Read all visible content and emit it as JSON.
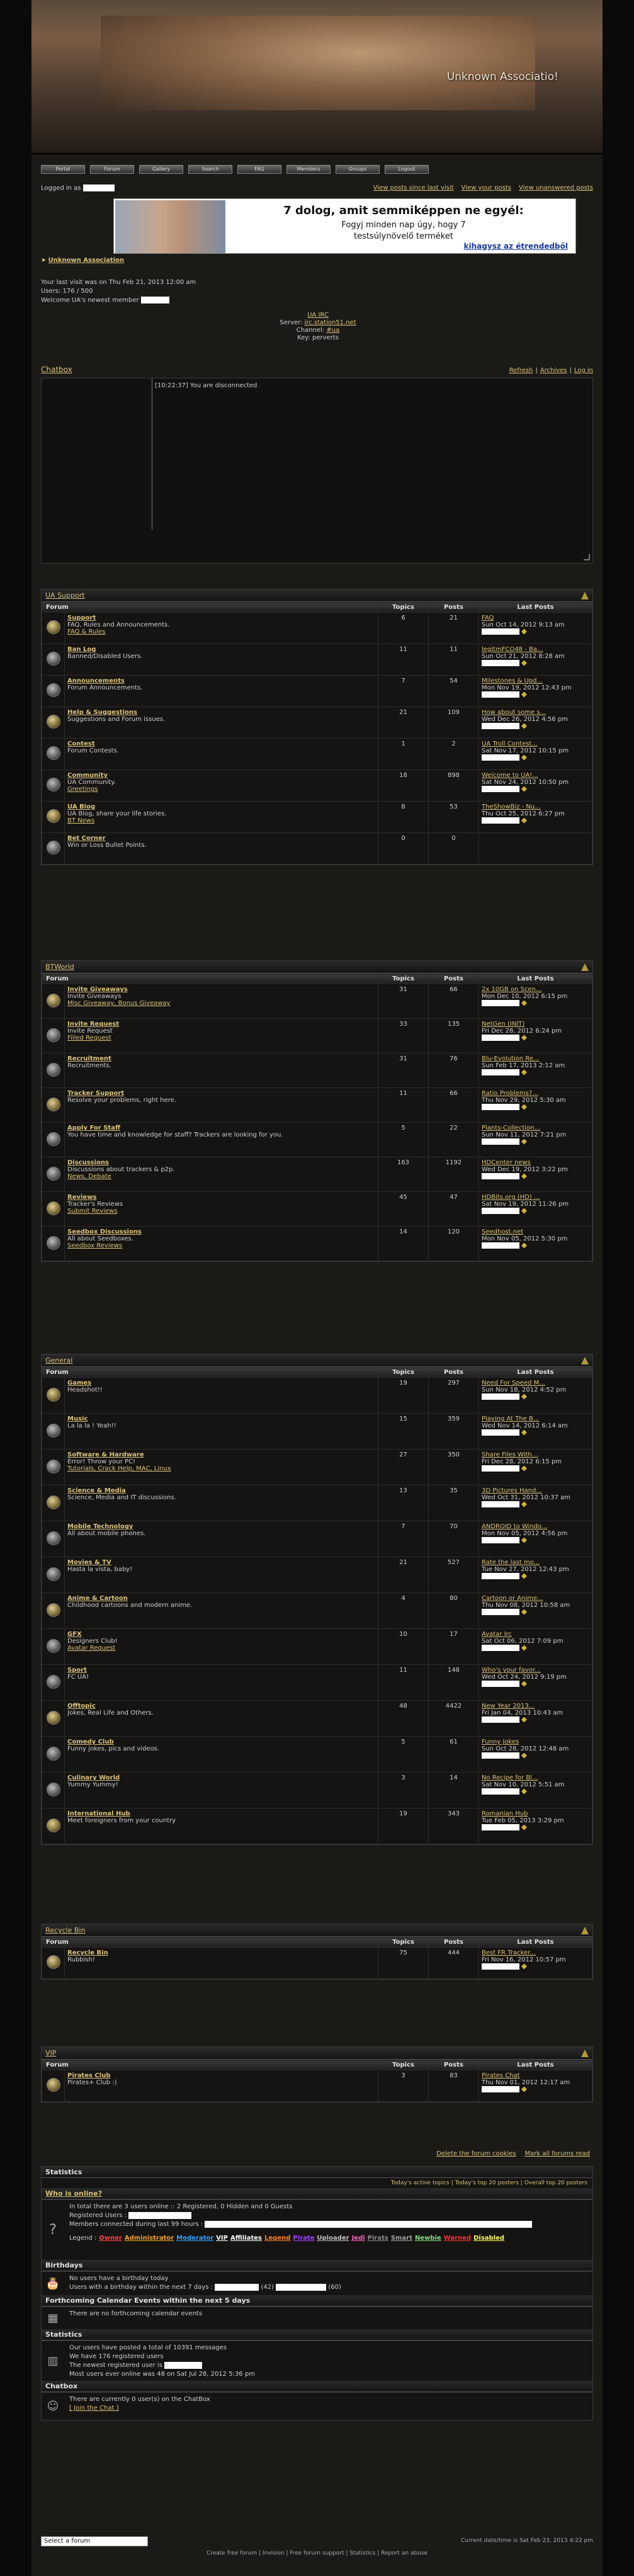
{
  "site": {
    "title": "Unknown Associatio!"
  },
  "nav": {
    "items": [
      "Portal",
      "Forum",
      "Gallery",
      "Search",
      "FAQ",
      "Members",
      "Groups",
      "Logout"
    ]
  },
  "header": {
    "logged_in_as": "Logged in as",
    "links": [
      "View posts since last visit",
      "View your posts",
      "View unanswered posts"
    ],
    "breadcrumb": "Unknown Association",
    "last_visit": "Your last visit was on Thu Feb 21, 2013 12:00 am",
    "users": "Users: 176 / 500",
    "newest": "Welcome UA's newest member"
  },
  "ad": {
    "headline": "7 dolog, amit semmiképpen ne egyél:",
    "line1": "Fogyj minden nap úgy, hogy 7",
    "line2": "testsúlynövelő terméket",
    "cta": "kihagysz az étrendedből"
  },
  "irc": {
    "title": "UA IRC",
    "server_label": "Server:",
    "server": "irc.station51.net",
    "channel_label": "Channel:",
    "channel": "#ua",
    "key": "Key: perverts"
  },
  "chatbox": {
    "title": "Chatbox",
    "links": [
      "Refresh",
      "Archives",
      "Log in"
    ],
    "message": "[10:22:37] You are disconnected"
  },
  "table_headers": {
    "forum": "Forum",
    "topics": "Topics",
    "posts": "Posts",
    "last": "Last Posts"
  },
  "categories": [
    {
      "name": "UA Support",
      "forums": [
        {
          "name": "Support",
          "desc": "FAQ, Rules and Announcements.",
          "sub": "FAQ & Rules",
          "topics": "6",
          "posts": "21",
          "last_title": "FAQ",
          "last_date": "Sun Oct 14, 2012 9:13 am"
        },
        {
          "name": "Ban Log",
          "desc": "Banned/Disabled Users.",
          "sub": "",
          "topics": "11",
          "posts": "11",
          "last_title": "legitmFCO48 - Ba...",
          "last_date": "Sun Oct 21, 2012 8:28 am"
        },
        {
          "name": "Announcements",
          "desc": "Forum Announcements.",
          "sub": "",
          "topics": "7",
          "posts": "54",
          "last_title": "Milestones & Upd...",
          "last_date": "Mon Nov 19, 2012 12:43 pm"
        },
        {
          "name": "Help & Suggestions",
          "desc": "Suggestions and Forum issues.",
          "sub": "",
          "topics": "21",
          "posts": "109",
          "last_title": "How about some s...",
          "last_date": "Wed Dec 26, 2012 4:56 pm"
        },
        {
          "name": "Contest",
          "desc": "Forum Contests.",
          "sub": "",
          "topics": "1",
          "posts": "2",
          "last_title": "UA Troll Contest...",
          "last_date": "Sat Nov 17, 2012 10:15 pm"
        },
        {
          "name": "Community",
          "desc": "UA Community.",
          "sub": "Greetings",
          "topics": "18",
          "posts": "898",
          "last_title": "Welcome to UA!...",
          "last_date": "Sat Nov 24, 2012 10:50 pm"
        },
        {
          "name": "UA Blog",
          "desc": "UA Blog, share your life stories.",
          "sub": "BT News",
          "topics": "8",
          "posts": "53",
          "last_title": "TheShowBiz - Nu...",
          "last_date": "Thu Oct 25, 2012 6:27 pm"
        },
        {
          "name": "Bet Corner",
          "desc": "Win or Loss Bullet Points.",
          "sub": "",
          "topics": "0",
          "posts": "0",
          "last_title": "",
          "last_date": ""
        }
      ]
    },
    {
      "name": "BTWorld",
      "forums": [
        {
          "name": "Invite Giveaways",
          "desc": "Invite Giveaways",
          "sub": "Misc Giveaway, Bonus Giveaway",
          "topics": "31",
          "posts": "66",
          "last_title": "2x 10GB on Scen...",
          "last_date": "Mon Dec 10, 2012 6:15 pm"
        },
        {
          "name": "Invite Request",
          "desc": "Invite Request",
          "sub": "Filled Request",
          "topics": "33",
          "posts": "135",
          "last_title": "NetGen (INIT)",
          "last_date": "Fri Dec 28, 2012 6:24 pm"
        },
        {
          "name": "Recruitment",
          "desc": "Recruitments.",
          "sub": "",
          "topics": "31",
          "posts": "76",
          "last_title": "Blu-Evolution Re...",
          "last_date": "Sun Feb 17, 2013 2:12 am"
        },
        {
          "name": "Tracker Support",
          "desc": "Resolve your problems, right here.",
          "sub": "",
          "topics": "11",
          "posts": "66",
          "last_title": "Ratio Problems?...",
          "last_date": "Thu Nov 29, 2012 5:30 am"
        },
        {
          "name": "Apply For Staff",
          "desc": "You have time and knowledge for staff? Trackers are looking for you.",
          "sub": "",
          "topics": "5",
          "posts": "22",
          "last_title": "Plants-Collection...",
          "last_date": "Sun Nov 11, 2012 7:21 pm"
        },
        {
          "name": "Discussions",
          "desc": "Discussions about trackers & p2p.",
          "sub": "News, Debate",
          "topics": "163",
          "posts": "1192",
          "last_title": "HDCenter news",
          "last_date": "Wed Dec 19, 2012 3:22 pm"
        },
        {
          "name": "Reviews",
          "desc": "Tracker's Reviews",
          "sub": "Submit Reviews",
          "topics": "45",
          "posts": "47",
          "last_title": "HDBits.org (HD) ...",
          "last_date": "Sat Nov 19, 2012 11:26 pm"
        },
        {
          "name": "Seedbox Discussions",
          "desc": "All about Seedboxes.",
          "sub": "Seedbox Reviews",
          "topics": "14",
          "posts": "120",
          "last_title": "Seedhost.net",
          "last_date": "Mon Nov 05, 2012 5:30 pm"
        }
      ]
    },
    {
      "name": "General",
      "forums": [
        {
          "name": "Games",
          "desc": "Headshot!!",
          "sub": "",
          "topics": "19",
          "posts": "297",
          "last_title": "Need For Speed M...",
          "last_date": "Sun Nov 18, 2012 4:52 pm"
        },
        {
          "name": "Music",
          "desc": "La la la ! Yeah!!",
          "sub": "",
          "topics": "15",
          "posts": "359",
          "last_title": "Playing At The B...",
          "last_date": "Wed Nov 14, 2012 6:14 am"
        },
        {
          "name": "Software & Hardware",
          "desc": "Error! Throw your PC!",
          "sub": "Tutorials, Crack Help, MAC, Linux",
          "topics": "27",
          "posts": "350",
          "last_title": "Share Files With...",
          "last_date": "Fri Dec 28, 2012 6:15 pm"
        },
        {
          "name": "Science & Media",
          "desc": "Science, Media and IT discussions.",
          "sub": "",
          "topics": "13",
          "posts": "35",
          "last_title": "3D Pictures Hand...",
          "last_date": "Wed Oct 31, 2012 10:37 am"
        },
        {
          "name": "Mobile Technology",
          "desc": "All about mobile phones.",
          "sub": "",
          "topics": "7",
          "posts": "70",
          "last_title": "ANDROID to Windo...",
          "last_date": "Mon Nov 05, 2012 4:56 pm"
        },
        {
          "name": "Movies & TV",
          "desc": "Hasta la vista, baby!",
          "sub": "",
          "topics": "21",
          "posts": "527",
          "last_title": "Rate the last mo...",
          "last_date": "Tue Nov 27, 2012 12:43 pm"
        },
        {
          "name": "Anime & Cartoon",
          "desc": "Childhood cartoons and modern anime.",
          "sub": "",
          "topics": "4",
          "posts": "80",
          "last_title": "Cartoon or Anime...",
          "last_date": "Thu Nov 08, 2012 10:58 am"
        },
        {
          "name": "GFX",
          "desc": "Designers Club!",
          "sub": "Avatar Request",
          "topics": "10",
          "posts": "17",
          "last_title": "Avatar Irc",
          "last_date": "Sat Oct 06, 2012 7:09 pm"
        },
        {
          "name": "Sport",
          "desc": "FC UA!",
          "sub": "",
          "topics": "11",
          "posts": "148",
          "last_title": "Who's your favor...",
          "last_date": "Wed Oct 24, 2012 9:19 pm"
        },
        {
          "name": "Offtopic",
          "desc": "Jokes, Real Life and Others.",
          "sub": "",
          "topics": "48",
          "posts": "4422",
          "last_title": "New Year 2013...",
          "last_date": "Fri Jan 04, 2013 10:43 am"
        },
        {
          "name": "Comedy Club",
          "desc": "Funny jokes, pics and videos.",
          "sub": "",
          "topics": "5",
          "posts": "61",
          "last_title": "Funny Jokes",
          "last_date": "Sun Oct 28, 2012 12:48 am"
        },
        {
          "name": "Culinary World",
          "desc": "Yummy Yummy!",
          "sub": "",
          "topics": "3",
          "posts": "14",
          "last_title": "No Recipe for Bl...",
          "last_date": "Sat Nov 10, 2012 5:51 am"
        },
        {
          "name": "International Hub",
          "desc": "Meet foreigners from your country",
          "sub": "",
          "topics": "19",
          "posts": "343",
          "last_title": "Romanian Hub",
          "last_date": "Tue Feb 05, 2013 3:29 pm"
        }
      ]
    },
    {
      "name": "Recycle Bin",
      "forums": [
        {
          "name": "Recycle Bin",
          "desc": "Rubbish!",
          "sub": "",
          "topics": "75",
          "posts": "444",
          "last_title": "Best FR Tracker...",
          "last_date": "Fri Nov 16, 2012 10:57 pm"
        }
      ]
    },
    {
      "name": "VIP",
      "forums": [
        {
          "name": "Pirates Club",
          "desc": "Pirates+ Club :)",
          "sub": "",
          "topics": "3",
          "posts": "83",
          "last_title": "Pirates Chat",
          "last_date": "Thu Nov 01, 2012 12:17 am"
        }
      ]
    }
  ],
  "bottom_links": [
    "Delete the forum cookies",
    "Mark all forums read"
  ],
  "stats": {
    "title": "Statistics",
    "top_links": "Today's active topics  |  Today's top 20 posters  |  Overall top 20 posters",
    "who_online": "Who is online?",
    "online_text": "In total there are 3 users online :: 2 Registered, 0 Hidden and 0 Guests",
    "registered_users": "Registered Users :",
    "connected": "Members connected during last 99 hours :",
    "legend_label": "Legend :",
    "legend": [
      "Owner",
      "Administrator",
      "Moderator",
      "VIP",
      "Affiliates",
      "Legend",
      "Pirate",
      "Uploader",
      "Jedi",
      "Pirats",
      "Smart",
      "Newbie",
      "Warned",
      "Disabled"
    ],
    "birthdays_title": "Birthdays",
    "birthdays_none": "No users have a birthday today",
    "birthdays_next": "Users with a birthday within the next 7 days :",
    "birthdays_age1": "(42)",
    "birthdays_age2": "(60)",
    "calendar_title": "Forthcoming Calendar Events within the next 5 days",
    "calendar_none": "There are no forthcoming calendar events",
    "statistics_title": "Statistics",
    "stat1": "Our users have posted a total of 10391 messages",
    "stat2": "We have 176 registered users",
    "stat3": "The newest registered user is",
    "stat4": "Most users ever online was 48 on Sat Jul 28, 2012 5:36 pm",
    "chatbox_title": "Chatbox",
    "chatbox_text": "There are currently 0 user(s) on the ChatBox",
    "chatbox_join": "[ Join the Chat ]"
  },
  "footer": {
    "jump": "Select a forum",
    "datetime": "Current date/time is Sat Feb 23, 2013 4:22 pm",
    "links": "Create free forum | Invision | Free forum support | Statistics | Report an abuse"
  },
  "colors": {
    "accent": "#d9c27a",
    "bg": "#1b1a17"
  }
}
